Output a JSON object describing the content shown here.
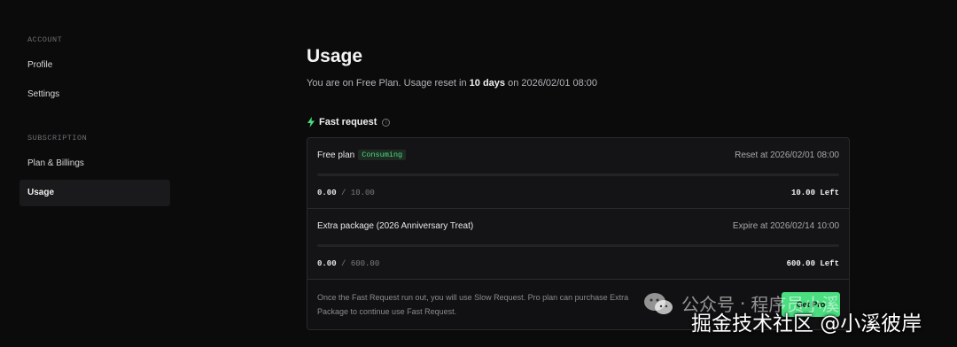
{
  "sidebar": {
    "account_label": "ACCOUNT",
    "profile": "Profile",
    "settings": "Settings",
    "subscription_label": "SUBSCRIPTION",
    "plan_billings": "Plan & Billings",
    "usage": "Usage"
  },
  "page": {
    "title": "Usage",
    "subtitle_prefix": "You are on Free Plan. Usage reset in ",
    "subtitle_bold": "10 days",
    "subtitle_suffix": " on 2026/02/01 08:00"
  },
  "section": {
    "title": "Fast request",
    "info_glyph": "i"
  },
  "plans": [
    {
      "name": "Free plan",
      "badge": "Consuming",
      "date_text": "Reset at 2026/02/01 08:00",
      "used": "0.00",
      "total": "/ 10.00",
      "left": "10.00 Left",
      "progress": 0
    },
    {
      "name": "Extra package (2026 Anniversary Treat)",
      "badge": "",
      "date_text": "Expire at 2026/02/14 10:00",
      "used": "0.00",
      "total": "/ 600.00",
      "left": "600.00 Left",
      "progress": 0
    }
  ],
  "footer": {
    "text": "Once the Fast Request run out, you will use Slow Request. Pro plan can purchase Extra Package to continue use Fast Request.",
    "button": "Get Pro"
  },
  "watermark": {
    "line1_a": "公众号",
    "line1_sep": "·",
    "line1_b": "程序员小溪",
    "line2": "掘金技术社区 @小溪彼岸"
  },
  "colors": {
    "accent": "#4ade80",
    "background": "#0b0b0c",
    "card": "#141416"
  }
}
